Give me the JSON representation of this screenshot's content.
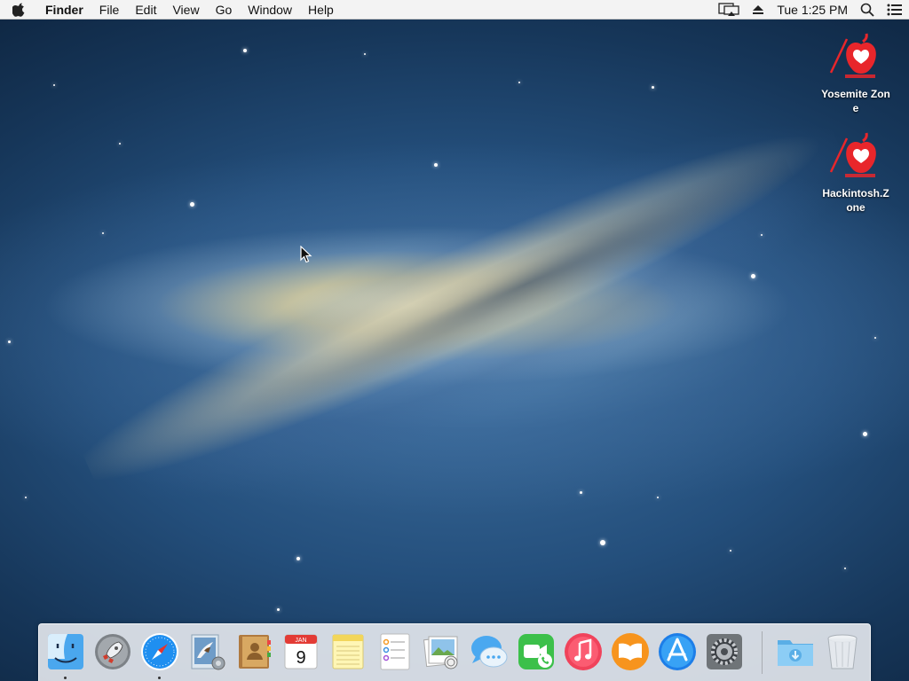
{
  "menubar": {
    "app_name": "Finder",
    "menus": [
      "File",
      "Edit",
      "View",
      "Go",
      "Window",
      "Help"
    ],
    "clock": "Tue 1:25 PM"
  },
  "desktop": {
    "icons": [
      {
        "label": "Yosemite Zone"
      },
      {
        "label": "Hackintosh.Zone"
      }
    ]
  },
  "dock": {
    "apps": [
      {
        "name": "Finder",
        "icon": "finder-icon",
        "running": true
      },
      {
        "name": "Launchpad",
        "icon": "launchpad-icon",
        "running": false
      },
      {
        "name": "Safari",
        "icon": "safari-icon",
        "running": true
      },
      {
        "name": "Mail",
        "icon": "mail-icon",
        "running": false
      },
      {
        "name": "Contacts",
        "icon": "contacts-icon",
        "running": false
      },
      {
        "name": "Calendar",
        "icon": "calendar-icon",
        "running": false,
        "month": "JAN",
        "day": "9"
      },
      {
        "name": "Notes",
        "icon": "notes-icon",
        "running": false
      },
      {
        "name": "Reminders",
        "icon": "reminders-icon",
        "running": false
      },
      {
        "name": "Preview",
        "icon": "preview-icon",
        "running": false
      },
      {
        "name": "Messages",
        "icon": "messages-icon",
        "running": false
      },
      {
        "name": "FaceTime",
        "icon": "facetime-icon",
        "running": false
      },
      {
        "name": "iTunes",
        "icon": "itunes-icon",
        "running": false
      },
      {
        "name": "iBooks",
        "icon": "ibooks-icon",
        "running": false
      },
      {
        "name": "App Store",
        "icon": "app-store-icon",
        "running": false
      },
      {
        "name": "System Preferences",
        "icon": "system-preferences-icon",
        "running": false
      },
      {
        "name": "Downloads",
        "icon": "downloads-folder-icon",
        "running": false
      },
      {
        "name": "Trash",
        "icon": "trash-icon",
        "running": false
      }
    ]
  },
  "colors": {
    "brand_red": "#e8262b",
    "menubar_bg": "#f3f3f3"
  }
}
